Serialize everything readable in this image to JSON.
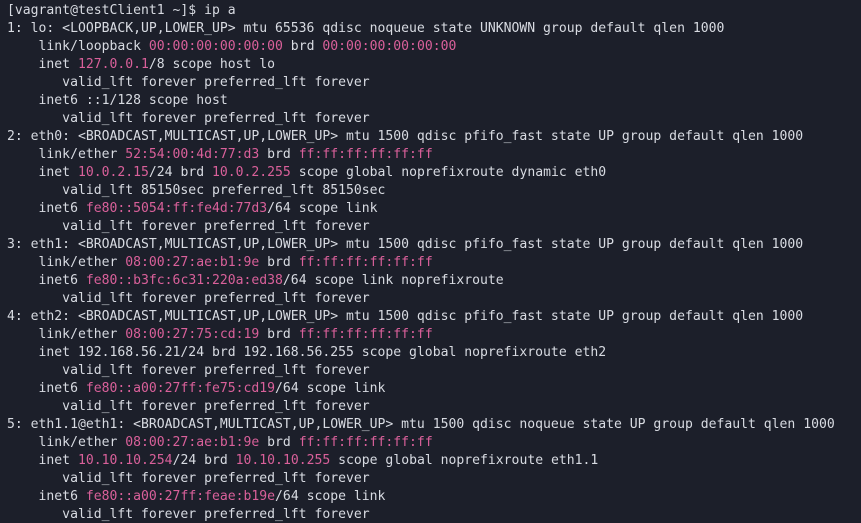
{
  "colors": {
    "background": "#1c1f2a",
    "text": "#d8dbe2",
    "address": "#d9609a",
    "highlight": "#8ab35a"
  },
  "terminal": {
    "lines": [
      [
        {
          "t": "[vagrant@testClient1 ~]$ ip a",
          "c": ""
        }
      ],
      [
        {
          "t": "1: lo: <LOOPBACK,UP,LOWER_UP> mtu 65536 qdisc noqueue state UNKNOWN group default qlen 1000",
          "c": ""
        }
      ],
      [
        {
          "t": "    link/loopback ",
          "c": ""
        },
        {
          "t": "00:00:00:00:00:00",
          "c": "pink"
        },
        {
          "t": " brd ",
          "c": ""
        },
        {
          "t": "00:00:00:00:00:00",
          "c": "pink"
        }
      ],
      [
        {
          "t": "    inet ",
          "c": ""
        },
        {
          "t": "127.0.0.1",
          "c": "pink"
        },
        {
          "t": "/8 scope host lo",
          "c": ""
        }
      ],
      [
        {
          "t": "       valid_lft forever preferred_lft forever",
          "c": ""
        }
      ],
      [
        {
          "t": "    inet6 ::1/128 scope host",
          "c": ""
        }
      ],
      [
        {
          "t": "       valid_lft forever preferred_lft forever",
          "c": ""
        }
      ],
      [
        {
          "t": "2: eth0: <BROADCAST,MULTICAST,UP,LOWER_UP> mtu 1500 qdisc pfifo_fast state UP group default qlen 1000",
          "c": ""
        }
      ],
      [
        {
          "t": "    link/ether ",
          "c": ""
        },
        {
          "t": "52:54:00:4d:77:d3",
          "c": "pink"
        },
        {
          "t": " brd ",
          "c": ""
        },
        {
          "t": "ff:ff:ff:ff:ff:ff",
          "c": "pink"
        }
      ],
      [
        {
          "t": "    inet ",
          "c": ""
        },
        {
          "t": "10.0.2.15",
          "c": "pink"
        },
        {
          "t": "/24 brd ",
          "c": ""
        },
        {
          "t": "10.0.2.255",
          "c": "pink"
        },
        {
          "t": " scope global noprefixroute dynamic eth0",
          "c": ""
        }
      ],
      [
        {
          "t": "       valid_lft 85150sec preferred_lft 85150sec",
          "c": ""
        }
      ],
      [
        {
          "t": "    inet6 ",
          "c": ""
        },
        {
          "t": "fe80::5054:ff:fe4d:77d3",
          "c": "pink"
        },
        {
          "t": "/64 scope link",
          "c": ""
        }
      ],
      [
        {
          "t": "       valid_lft forever preferred_lft forever",
          "c": ""
        }
      ],
      [
        {
          "t": "3: eth1: <BROADCAST,MULTICAST,UP,LOWER_UP> mtu 1500 qdisc pfifo_fast state UP group default qlen 1000",
          "c": ""
        }
      ],
      [
        {
          "t": "    link/ether ",
          "c": ""
        },
        {
          "t": "08:00:27:ae:b1:9e",
          "c": "pink"
        },
        {
          "t": " brd ",
          "c": ""
        },
        {
          "t": "ff:ff:ff:ff:ff:ff",
          "c": "pink"
        }
      ],
      [
        {
          "t": "    inet6 ",
          "c": ""
        },
        {
          "t": "fe80::b3fc:6c31:220a:ed38",
          "c": "pink"
        },
        {
          "t": "/64 scope link noprefixroute",
          "c": ""
        }
      ],
      [
        {
          "t": "       valid_lft forever preferred_lft forever",
          "c": ""
        }
      ],
      [
        {
          "t": "4: eth2: <BROADCAST,MULTICAST,UP,LOWER_UP> mtu 1500 qdisc pfifo_fast state UP group default qlen 1000",
          "c": ""
        }
      ],
      [
        {
          "t": "    link/ether ",
          "c": ""
        },
        {
          "t": "08:00:27:75:cd:19",
          "c": "pink"
        },
        {
          "t": " brd ",
          "c": ""
        },
        {
          "t": "ff:ff:ff:ff:ff:ff",
          "c": "pink"
        }
      ],
      [
        {
          "t": "    inet 192.168.56.21/24 brd 192.168.56.255 scope global noprefixroute eth2",
          "c": ""
        }
      ],
      [
        {
          "t": "       valid_lft forever preferred_lft forever",
          "c": ""
        }
      ],
      [
        {
          "t": "    inet6 ",
          "c": ""
        },
        {
          "t": "fe80::a00:27ff:fe75:cd19",
          "c": "pink"
        },
        {
          "t": "/64 scope link",
          "c": ""
        }
      ],
      [
        {
          "t": "       valid_lft forever preferred_lft forever",
          "c": ""
        }
      ],
      [
        {
          "t": "5: eth1.1@eth1: <BROADCAST,MULTICAST,UP,LOWER_UP> mtu 1500 qdisc noqueue state UP group default qlen 1000",
          "c": ""
        }
      ],
      [
        {
          "t": "    link/ether ",
          "c": ""
        },
        {
          "t": "08:00:27:ae:b1:9e",
          "c": "pink"
        },
        {
          "t": " brd ",
          "c": ""
        },
        {
          "t": "ff:ff:ff:ff:ff:ff",
          "c": "pink"
        }
      ],
      [
        {
          "t": "    inet ",
          "c": ""
        },
        {
          "t": "10.10.10.254",
          "c": "pink"
        },
        {
          "t": "/24 brd ",
          "c": ""
        },
        {
          "t": "10.10.10.255",
          "c": "pink"
        },
        {
          "t": " scope global noprefixroute eth1.1",
          "c": ""
        }
      ],
      [
        {
          "t": "       valid_lft forever preferred_lft forever",
          "c": ""
        }
      ],
      [
        {
          "t": "    inet6 ",
          "c": ""
        },
        {
          "t": "fe80::a00:27ff:feae:b19e",
          "c": "pink"
        },
        {
          "t": "/64 scope link",
          "c": ""
        }
      ],
      [
        {
          "t": "       valid_lft forever preferred_lft forever",
          "c": ""
        }
      ]
    ]
  }
}
